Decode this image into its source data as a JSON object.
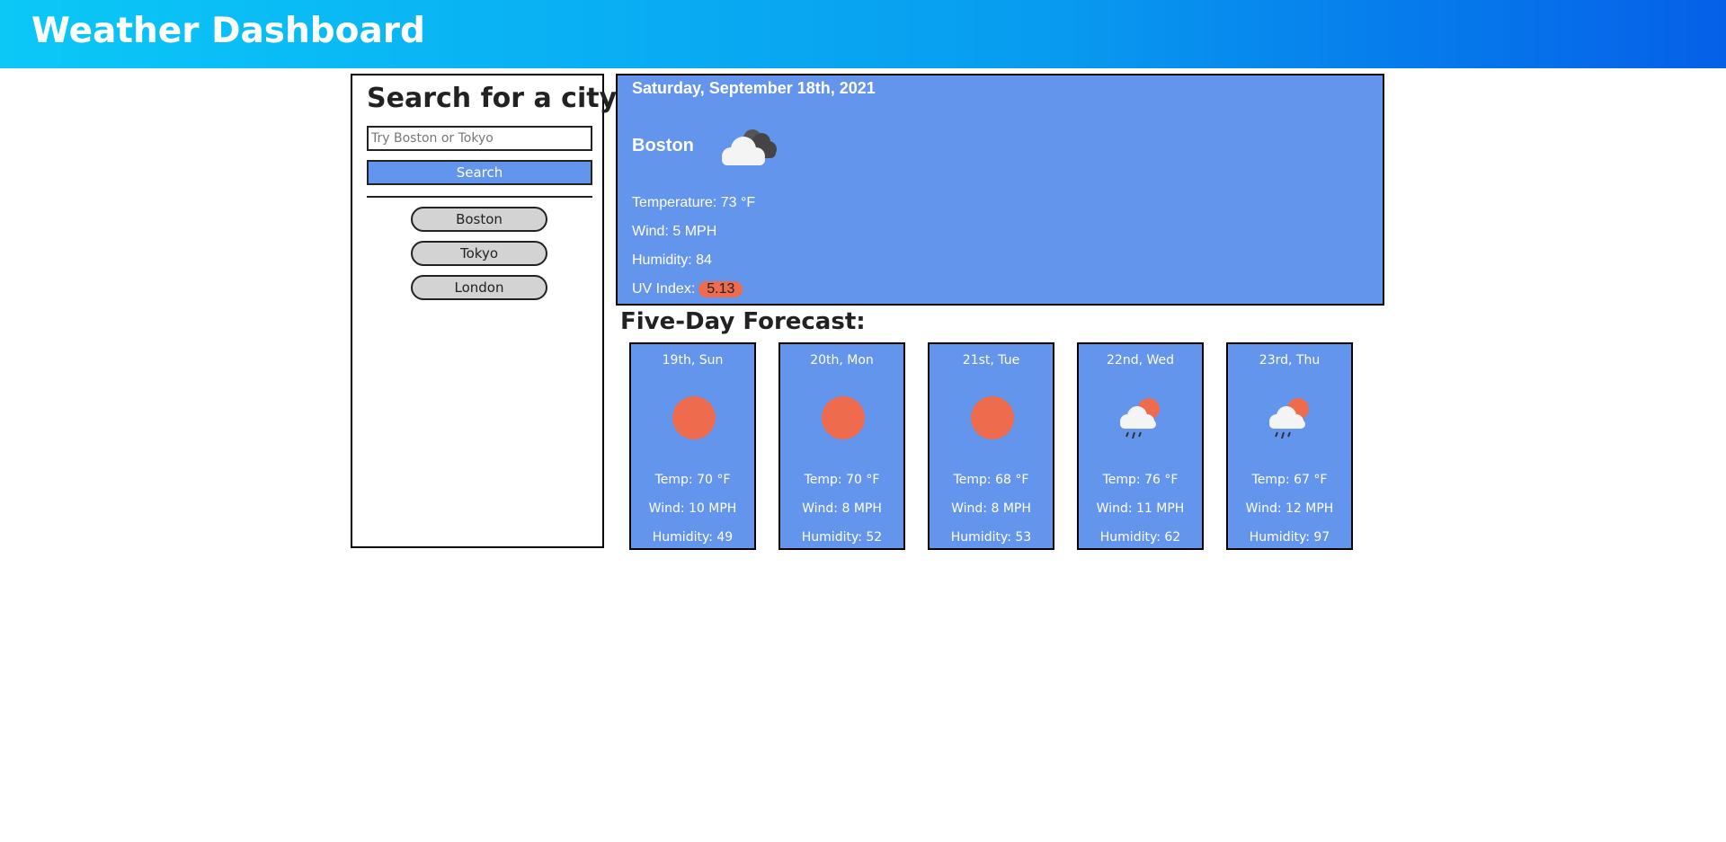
{
  "header": {
    "title": "Weather Dashboard"
  },
  "search": {
    "title": "Search for a city:",
    "placeholder": "Try Boston or Tokyo",
    "value": "",
    "button_label": "Search",
    "history": [
      "Boston",
      "Tokyo",
      "London"
    ]
  },
  "current": {
    "date": "Saturday, September 18th, 2021",
    "city": "Boston",
    "icon": "cloudy-icon",
    "temperature": "Temperature: 73 °F",
    "wind": "Wind: 5 MPH",
    "humidity": "Humidity: 84",
    "uv_label": "UV Index:",
    "uv_value": "5.13",
    "uv_color": "#ee6b4d"
  },
  "forecast": {
    "title": "Five-Day Forecast:",
    "days": [
      {
        "date": "19th, Sun",
        "icon": "sun-icon",
        "temp": "Temp: 70 °F",
        "wind": "Wind: 10 MPH",
        "humidity": "Humidity: 49"
      },
      {
        "date": "20th, Mon",
        "icon": "sun-icon",
        "temp": "Temp: 70 °F",
        "wind": "Wind: 8 MPH",
        "humidity": "Humidity: 52"
      },
      {
        "date": "21st, Tue",
        "icon": "sun-icon",
        "temp": "Temp: 68 °F",
        "wind": "Wind: 8 MPH",
        "humidity": "Humidity: 53"
      },
      {
        "date": "22nd, Wed",
        "icon": "rain-sun-icon",
        "temp": "Temp: 76 °F",
        "wind": "Wind: 11 MPH",
        "humidity": "Humidity: 62"
      },
      {
        "date": "23rd, Thu",
        "icon": "rain-sun-icon",
        "temp": "Temp: 67 °F",
        "wind": "Wind: 12 MPH",
        "humidity": "Humidity: 97"
      }
    ]
  },
  "colors": {
    "card_bg": "#6495ed",
    "sun": "#ee6b4d",
    "header_gradient_start": "#0bc8f7",
    "header_gradient_end": "#0560e8"
  }
}
